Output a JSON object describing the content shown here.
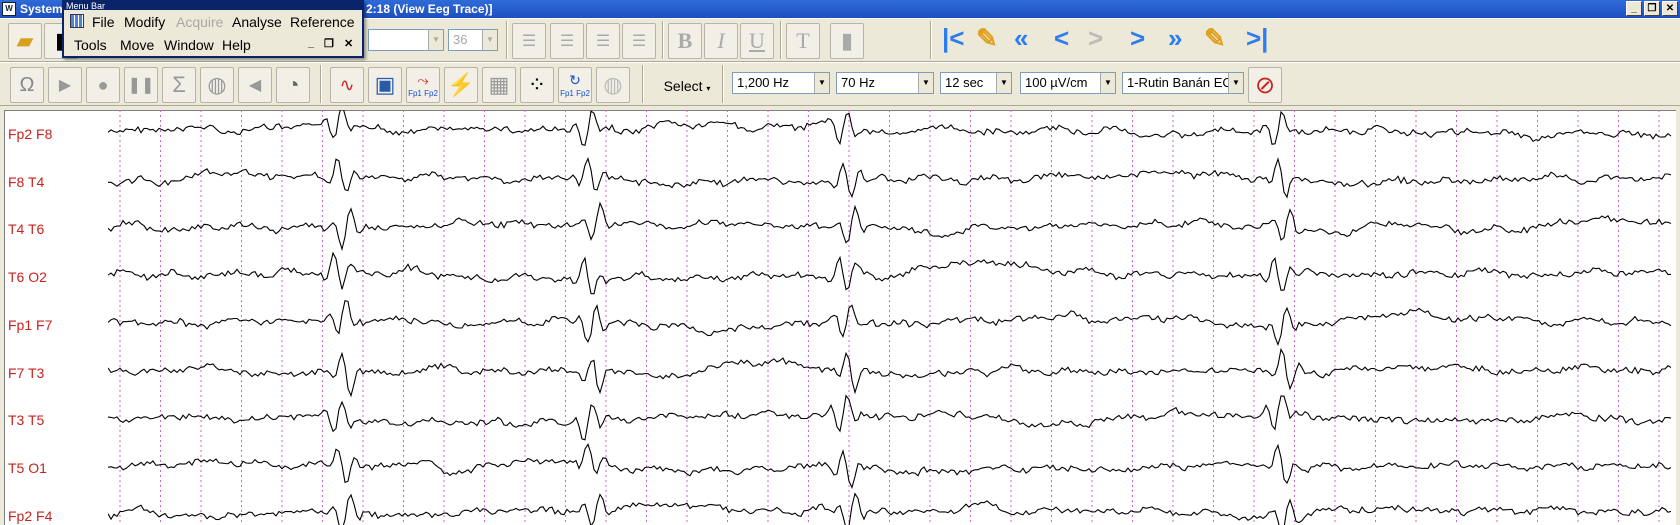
{
  "window": {
    "title": "System",
    "title_suffix": "2:18 (View Eeg Trace)]"
  },
  "menu": {
    "header": "Menu Bar",
    "row1": [
      "File",
      "Modify",
      "Acquire",
      "Analyse",
      "Reference"
    ],
    "row2": [
      "Tools",
      "Move",
      "Window",
      "Help"
    ],
    "disabled": [
      "Acquire"
    ]
  },
  "toolbar1": {
    "font_size_value": "36",
    "nav_icons": [
      "first-icon",
      "jump-back-icon",
      "fast-back-icon",
      "back-icon",
      "forward-disabled-icon",
      "forward-icon",
      "fast-forward-icon",
      "jump-forward-icon",
      "last-icon"
    ]
  },
  "toolbar2": {
    "select_label": "Select",
    "sample_rate": "1,200 Hz",
    "low_pass": "70 Hz",
    "time_base": "12 sec",
    "sensitivity": "100 µV/cm",
    "montage": "1-Rutin Banán EC",
    "fp_label": "Fp1 Fp2"
  },
  "channels": [
    "Fp2 F8",
    "F8 T4",
    "T4 T6",
    "T6 O2",
    "Fp1 F7",
    "F7 T3",
    "T3 T5",
    "T5 O1",
    "Fp2 F4"
  ],
  "colors": {
    "channel_label": "#c8231e",
    "grid_line": "#cc66cc",
    "trace": "#000000",
    "title_bar": "#1d4fbf"
  }
}
